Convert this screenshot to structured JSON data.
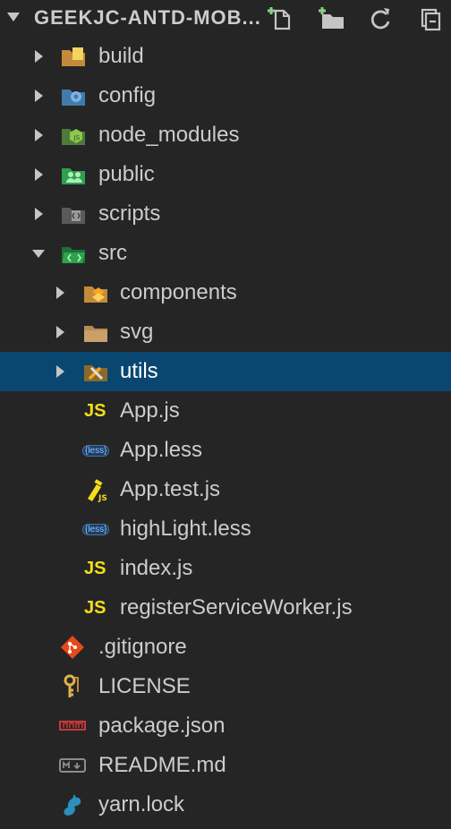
{
  "explorer": {
    "section_title": "GEEKJC-ANTD-MOB...",
    "actions": [
      {
        "name": "new-file-icon"
      },
      {
        "name": "new-folder-icon"
      },
      {
        "name": "refresh-icon"
      },
      {
        "name": "collapse-all-icon"
      }
    ]
  },
  "tree": [
    {
      "label": "build",
      "type": "folder",
      "icon": "build-folder-icon",
      "indent": 0,
      "state": "closed"
    },
    {
      "label": "config",
      "type": "folder",
      "icon": "config-folder-icon",
      "indent": 0,
      "state": "closed"
    },
    {
      "label": "node_modules",
      "type": "folder",
      "icon": "node-folder-icon",
      "indent": 0,
      "state": "closed"
    },
    {
      "label": "public",
      "type": "folder",
      "icon": "public-folder-icon",
      "indent": 0,
      "state": "closed"
    },
    {
      "label": "scripts",
      "type": "folder",
      "icon": "scripts-folder-icon",
      "indent": 0,
      "state": "closed"
    },
    {
      "label": "src",
      "type": "folder",
      "icon": "src-folder-icon",
      "indent": 0,
      "state": "open"
    },
    {
      "label": "components",
      "type": "folder",
      "icon": "components-folder-icon",
      "indent": 1,
      "state": "closed"
    },
    {
      "label": "svg",
      "type": "folder",
      "icon": "folder-icon",
      "indent": 1,
      "state": "closed"
    },
    {
      "label": "utils",
      "type": "folder",
      "icon": "utils-folder-icon",
      "indent": 1,
      "state": "closed",
      "selected": true
    },
    {
      "label": "App.js",
      "type": "file",
      "icon": "js-icon",
      "indent": 1
    },
    {
      "label": "App.less",
      "type": "file",
      "icon": "less-icon",
      "indent": 1
    },
    {
      "label": "App.test.js",
      "type": "file",
      "icon": "test-js-icon",
      "indent": 1
    },
    {
      "label": "highLight.less",
      "type": "file",
      "icon": "less-icon",
      "indent": 1
    },
    {
      "label": "index.js",
      "type": "file",
      "icon": "js-icon",
      "indent": 1
    },
    {
      "label": "registerServiceWorker.js",
      "type": "file",
      "icon": "js-icon",
      "indent": 1
    },
    {
      "label": ".gitignore",
      "type": "file",
      "icon": "git-icon",
      "indent": 0
    },
    {
      "label": "LICENSE",
      "type": "file",
      "icon": "license-key-icon",
      "indent": 0
    },
    {
      "label": "package.json",
      "type": "file",
      "icon": "npm-icon",
      "indent": 0
    },
    {
      "label": "README.md",
      "type": "file",
      "icon": "markdown-icon",
      "indent": 0
    },
    {
      "label": "yarn.lock",
      "type": "file",
      "icon": "yarn-icon",
      "indent": 0
    }
  ],
  "icon_text": {
    "js": "JS",
    "less": "{less}"
  },
  "colors": {
    "background": "#252526",
    "selected": "#094771",
    "text": "#cccccc",
    "js": "#f5de19"
  }
}
